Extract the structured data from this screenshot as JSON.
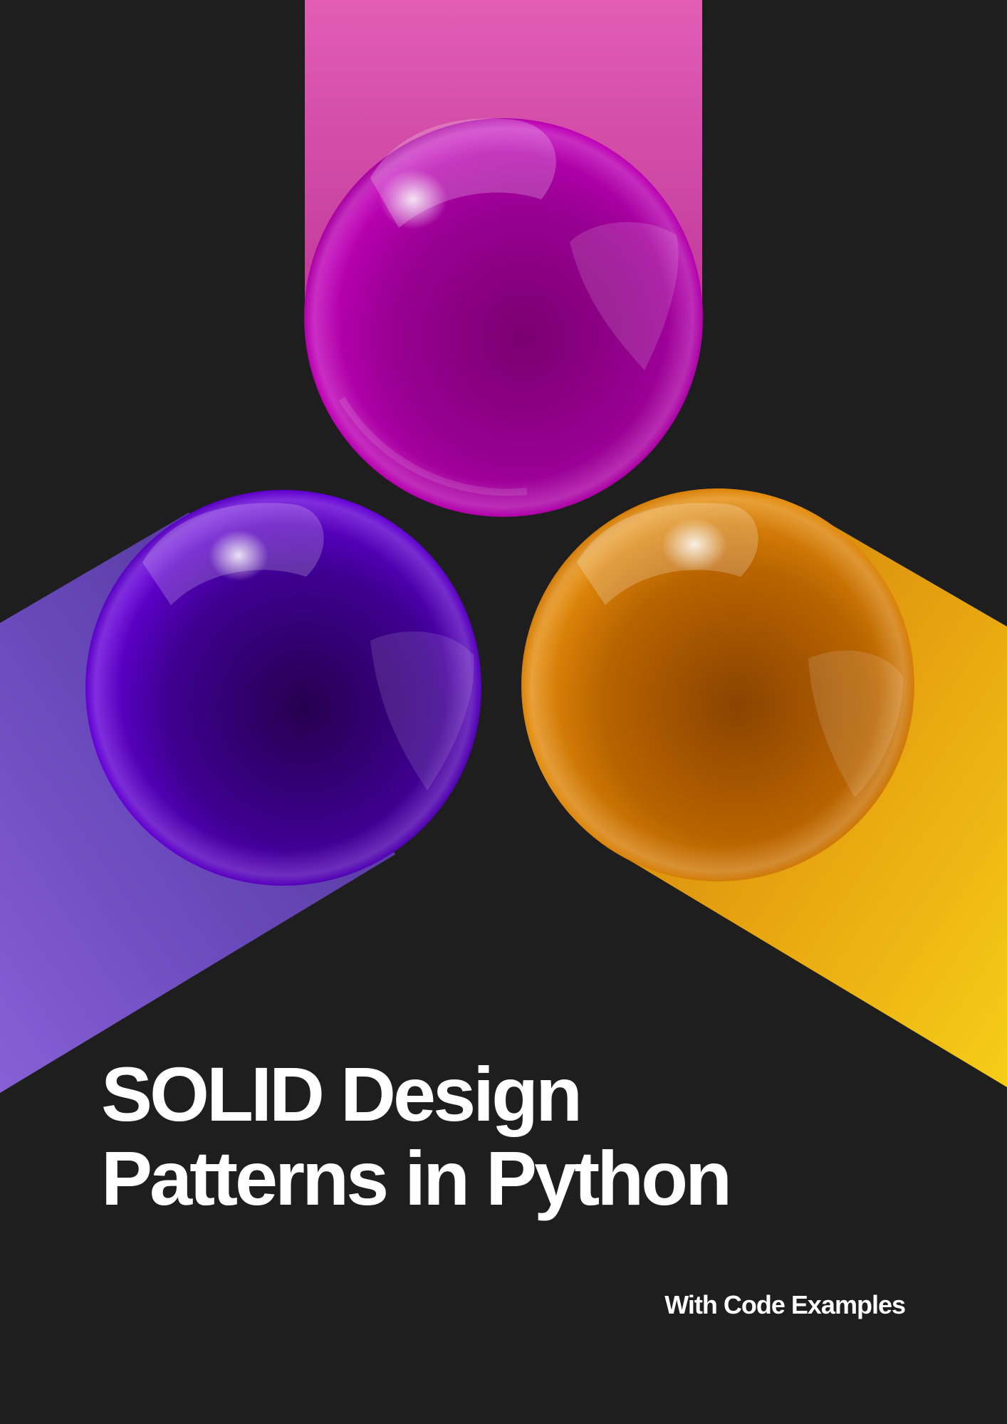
{
  "cover": {
    "title_line_1": "SOLID Design",
    "title_line_2": "Patterns in Python",
    "subtitle": "With Code Examples"
  },
  "colors": {
    "background": "#1e1e1e",
    "pink_beam": "#e05cb5",
    "magenta_sphere": "#b300b0",
    "violet_sphere": "#5a00c8",
    "violet_beam": "#7e5bd0",
    "orange_sphere": "#e0860a",
    "yellow_beam": "#f2c114",
    "text": "#ffffff"
  },
  "artwork": {
    "spheres": [
      "magenta-sphere",
      "violet-sphere",
      "orange-sphere"
    ],
    "beams": [
      "pink-beam",
      "violet-beam",
      "yellow-beam"
    ]
  }
}
